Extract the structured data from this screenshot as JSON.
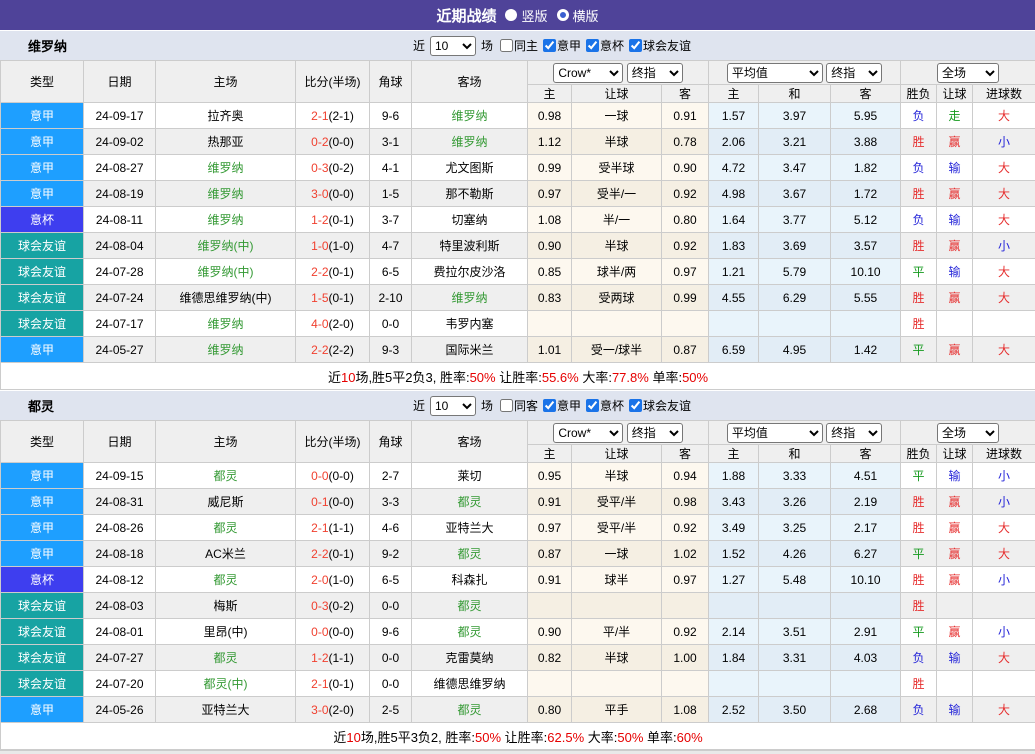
{
  "title_bar": {
    "title": "近期战绩",
    "vertical_label": "竖版",
    "horizontal_label": "横版"
  },
  "filter": {
    "near": "近",
    "games": "场"
  },
  "table_header": {
    "type": "类型",
    "date": "日期",
    "home": "主场",
    "score": "比分(半场)",
    "corner": "角球",
    "away": "客场",
    "crow_select": "Crow*",
    "final_select": "终指",
    "avg_select": "平均值",
    "final_select2": "终指",
    "full_select": "全场",
    "h": "主",
    "handicap": "让球",
    "a": "客",
    "avg_h": "主",
    "avg_d": "和",
    "avg_a": "客",
    "wdl": "胜负",
    "hcap_result": "让球",
    "goals": "进球数"
  },
  "colors": {
    "header_bg": "#4f4399",
    "section_bg": "#dfe4ef",
    "league": {
      "意甲": "#1e9fff",
      "意杯": "#3e3eef",
      "球会友谊": "#17a3a3"
    },
    "team_green": "#339933",
    "score_red": "#f0402f",
    "summary_red": "#e60000",
    "result": {
      "胜": "#e62e2e",
      "平": "#169a1f",
      "负": "#2626d9",
      "赢": "#e62e2e",
      "输": "#2626d9",
      "走": "#169a1f",
      "大": "#e62e2e",
      "小": "#2626d9"
    }
  },
  "sections": [
    {
      "team": "维罗纳",
      "filter_count": "10",
      "checkboxes": [
        {
          "label": "同主",
          "checked": false
        },
        {
          "label": "意甲",
          "checked": true
        },
        {
          "label": "意杯",
          "checked": true
        },
        {
          "label": "球会友谊",
          "checked": true
        }
      ],
      "rows": [
        {
          "type": "意甲",
          "date": "24-09-17",
          "home": "拉齐奥",
          "hg": false,
          "score": "2-1",
          "half": "(2-1)",
          "corner": "9-6",
          "away": "维罗纳",
          "ag": true,
          "crow_home": "0.98",
          "crow_hcap": "一球",
          "crow_away": "0.91",
          "avg_home": "1.57",
          "avg_draw": "3.97",
          "avg_away": "5.95",
          "wdl": "负",
          "hcap_res": "走",
          "goals_res": "大"
        },
        {
          "type": "意甲",
          "date": "24-09-02",
          "home": "热那亚",
          "hg": false,
          "score": "0-2",
          "half": "(0-0)",
          "corner": "3-1",
          "away": "维罗纳",
          "ag": true,
          "crow_home": "1.12",
          "crow_hcap": "半球",
          "crow_away": "0.78",
          "avg_home": "2.06",
          "avg_draw": "3.21",
          "avg_away": "3.88",
          "wdl": "胜",
          "hcap_res": "赢",
          "goals_res": "小"
        },
        {
          "type": "意甲",
          "date": "24-08-27",
          "home": "维罗纳",
          "hg": true,
          "score": "0-3",
          "half": "(0-2)",
          "corner": "4-1",
          "away": "尤文图斯",
          "ag": false,
          "crow_home": "0.99",
          "crow_hcap": "受半球",
          "crow_away": "0.90",
          "avg_home": "4.72",
          "avg_draw": "3.47",
          "avg_away": "1.82",
          "wdl": "负",
          "hcap_res": "输",
          "goals_res": "大"
        },
        {
          "type": "意甲",
          "date": "24-08-19",
          "home": "维罗纳",
          "hg": true,
          "score": "3-0",
          "half": "(0-0)",
          "corner": "1-5",
          "away": "那不勒斯",
          "ag": false,
          "crow_home": "0.97",
          "crow_hcap": "受半/一",
          "crow_away": "0.92",
          "avg_home": "4.98",
          "avg_draw": "3.67",
          "avg_away": "1.72",
          "wdl": "胜",
          "hcap_res": "赢",
          "goals_res": "大"
        },
        {
          "type": "意杯",
          "date": "24-08-11",
          "home": "维罗纳",
          "hg": true,
          "score": "1-2",
          "half": "(0-1)",
          "corner": "3-7",
          "away": "切塞纳",
          "ag": false,
          "crow_home": "1.08",
          "crow_hcap": "半/一",
          "crow_away": "0.80",
          "avg_home": "1.64",
          "avg_draw": "3.77",
          "avg_away": "5.12",
          "wdl": "负",
          "hcap_res": "输",
          "goals_res": "大"
        },
        {
          "type": "球会友谊",
          "date": "24-08-04",
          "home": "维罗纳(中)",
          "hg": true,
          "score": "1-0",
          "half": "(1-0)",
          "corner": "4-7",
          "away": "特里波利斯",
          "ag": false,
          "crow_home": "0.90",
          "crow_hcap": "半球",
          "crow_away": "0.92",
          "avg_home": "1.83",
          "avg_draw": "3.69",
          "avg_away": "3.57",
          "wdl": "胜",
          "hcap_res": "赢",
          "goals_res": "小"
        },
        {
          "type": "球会友谊",
          "date": "24-07-28",
          "home": "维罗纳(中)",
          "hg": true,
          "score": "2-2",
          "half": "(0-1)",
          "corner": "6-5",
          "away": "费拉尔皮沙洛",
          "ag": false,
          "crow_home": "0.85",
          "crow_hcap": "球半/两",
          "crow_away": "0.97",
          "avg_home": "1.21",
          "avg_draw": "5.79",
          "avg_away": "10.10",
          "wdl": "平",
          "hcap_res": "输",
          "goals_res": "大"
        },
        {
          "type": "球会友谊",
          "date": "24-07-24",
          "home": "维德思维罗纳(中)",
          "hg": false,
          "score": "1-5",
          "half": "(0-1)",
          "corner": "2-10",
          "away": "维罗纳",
          "ag": true,
          "crow_home": "0.83",
          "crow_hcap": "受两球",
          "crow_away": "0.99",
          "avg_home": "4.55",
          "avg_draw": "6.29",
          "avg_away": "5.55",
          "wdl": "胜",
          "hcap_res": "赢",
          "goals_res": "大"
        },
        {
          "type": "球会友谊",
          "date": "24-07-17",
          "home": "维罗纳",
          "hg": true,
          "score": "4-0",
          "half": "(2-0)",
          "corner": "0-0",
          "away": "韦罗内塞",
          "ag": false,
          "crow_home": "",
          "crow_hcap": "",
          "crow_away": "",
          "avg_home": "",
          "avg_draw": "",
          "avg_away": "",
          "wdl": "胜",
          "hcap_res": "",
          "goals_res": ""
        },
        {
          "type": "意甲",
          "date": "24-05-27",
          "home": "维罗纳",
          "hg": true,
          "score": "2-2",
          "half": "(2-2)",
          "corner": "9-3",
          "away": "国际米兰",
          "ag": false,
          "crow_home": "1.01",
          "crow_hcap": "受一/球半",
          "crow_away": "0.87",
          "avg_home": "6.59",
          "avg_draw": "4.95",
          "avg_away": "1.42",
          "wdl": "平",
          "hcap_res": "赢",
          "goals_res": "大"
        }
      ],
      "summary": [
        {
          "text": "近"
        },
        {
          "text": "10",
          "red": true
        },
        {
          "text": "场,胜5平2负3, 胜率:"
        },
        {
          "text": "50%",
          "red": true
        },
        {
          "text": " 让胜率:"
        },
        {
          "text": "55.6%",
          "red": true
        },
        {
          "text": " 大率:"
        },
        {
          "text": "77.8%",
          "red": true
        },
        {
          "text": " 单率:"
        },
        {
          "text": "50%",
          "red": true
        }
      ]
    },
    {
      "team": "都灵",
      "filter_count": "10",
      "checkboxes": [
        {
          "label": "同客",
          "checked": false
        },
        {
          "label": "意甲",
          "checked": true
        },
        {
          "label": "意杯",
          "checked": true
        },
        {
          "label": "球会友谊",
          "checked": true
        }
      ],
      "rows": [
        {
          "type": "意甲",
          "date": "24-09-15",
          "home": "都灵",
          "hg": true,
          "score": "0-0",
          "half": "(0-0)",
          "corner": "2-7",
          "away": "莱切",
          "ag": false,
          "crow_home": "0.95",
          "crow_hcap": "半球",
          "crow_away": "0.94",
          "avg_home": "1.88",
          "avg_draw": "3.33",
          "avg_away": "4.51",
          "wdl": "平",
          "hcap_res": "输",
          "goals_res": "小"
        },
        {
          "type": "意甲",
          "date": "24-08-31",
          "home": "威尼斯",
          "hg": false,
          "score": "0-1",
          "half": "(0-0)",
          "corner": "3-3",
          "away": "都灵",
          "ag": true,
          "crow_home": "0.91",
          "crow_hcap": "受平/半",
          "crow_away": "0.98",
          "avg_home": "3.43",
          "avg_draw": "3.26",
          "avg_away": "2.19",
          "wdl": "胜",
          "hcap_res": "赢",
          "goals_res": "小"
        },
        {
          "type": "意甲",
          "date": "24-08-26",
          "home": "都灵",
          "hg": true,
          "score": "2-1",
          "half": "(1-1)",
          "corner": "4-6",
          "away": "亚特兰大",
          "ag": false,
          "crow_home": "0.97",
          "crow_hcap": "受平/半",
          "crow_away": "0.92",
          "avg_home": "3.49",
          "avg_draw": "3.25",
          "avg_away": "2.17",
          "wdl": "胜",
          "hcap_res": "赢",
          "goals_res": "大"
        },
        {
          "type": "意甲",
          "date": "24-08-18",
          "home": "AC米兰",
          "hg": false,
          "score": "2-2",
          "half": "(0-1)",
          "corner": "9-2",
          "away": "都灵",
          "ag": true,
          "crow_home": "0.87",
          "crow_hcap": "一球",
          "crow_away": "1.02",
          "avg_home": "1.52",
          "avg_draw": "4.26",
          "avg_away": "6.27",
          "wdl": "平",
          "hcap_res": "赢",
          "goals_res": "大"
        },
        {
          "type": "意杯",
          "date": "24-08-12",
          "home": "都灵",
          "hg": true,
          "score": "2-0",
          "half": "(1-0)",
          "corner": "6-5",
          "away": "科森扎",
          "ag": false,
          "crow_home": "0.91",
          "crow_hcap": "球半",
          "crow_away": "0.97",
          "avg_home": "1.27",
          "avg_draw": "5.48",
          "avg_away": "10.10",
          "wdl": "胜",
          "hcap_res": "赢",
          "goals_res": "小"
        },
        {
          "type": "球会友谊",
          "date": "24-08-03",
          "home": "梅斯",
          "hg": false,
          "score": "0-3",
          "half": "(0-2)",
          "corner": "0-0",
          "away": "都灵",
          "ag": true,
          "crow_home": "",
          "crow_hcap": "",
          "crow_away": "",
          "avg_home": "",
          "avg_draw": "",
          "avg_away": "",
          "wdl": "胜",
          "hcap_res": "",
          "goals_res": ""
        },
        {
          "type": "球会友谊",
          "date": "24-08-01",
          "home": "里昂(中)",
          "hg": false,
          "score": "0-0",
          "half": "(0-0)",
          "corner": "9-6",
          "away": "都灵",
          "ag": true,
          "crow_home": "0.90",
          "crow_hcap": "平/半",
          "crow_away": "0.92",
          "avg_home": "2.14",
          "avg_draw": "3.51",
          "avg_away": "2.91",
          "wdl": "平",
          "hcap_res": "赢",
          "goals_res": "小"
        },
        {
          "type": "球会友谊",
          "date": "24-07-27",
          "home": "都灵",
          "hg": true,
          "score": "1-2",
          "half": "(1-1)",
          "corner": "0-0",
          "away": "克雷莫纳",
          "ag": false,
          "crow_home": "0.82",
          "crow_hcap": "半球",
          "crow_away": "1.00",
          "avg_home": "1.84",
          "avg_draw": "3.31",
          "avg_away": "4.03",
          "wdl": "负",
          "hcap_res": "输",
          "goals_res": "大"
        },
        {
          "type": "球会友谊",
          "date": "24-07-20",
          "home": "都灵(中)",
          "hg": true,
          "score": "2-1",
          "half": "(0-1)",
          "corner": "0-0",
          "away": "维德思维罗纳",
          "ag": false,
          "crow_home": "",
          "crow_hcap": "",
          "crow_away": "",
          "avg_home": "",
          "avg_draw": "",
          "avg_away": "",
          "wdl": "胜",
          "hcap_res": "",
          "goals_res": ""
        },
        {
          "type": "意甲",
          "date": "24-05-26",
          "home": "亚特兰大",
          "hg": false,
          "score": "3-0",
          "half": "(2-0)",
          "corner": "2-5",
          "away": "都灵",
          "ag": true,
          "crow_home": "0.80",
          "crow_hcap": "平手",
          "crow_away": "1.08",
          "avg_home": "2.52",
          "avg_draw": "3.50",
          "avg_away": "2.68",
          "wdl": "负",
          "hcap_res": "输",
          "goals_res": "大"
        }
      ],
      "summary": [
        {
          "text": "近"
        },
        {
          "text": "10",
          "red": true
        },
        {
          "text": "场,胜5平3负2, 胜率:"
        },
        {
          "text": "50%",
          "red": true
        },
        {
          "text": " 让胜率:"
        },
        {
          "text": "62.5%",
          "red": true
        },
        {
          "text": " 大率:"
        },
        {
          "text": "50%",
          "red": true
        },
        {
          "text": " 单率:"
        },
        {
          "text": "60%",
          "red": true
        }
      ]
    }
  ]
}
